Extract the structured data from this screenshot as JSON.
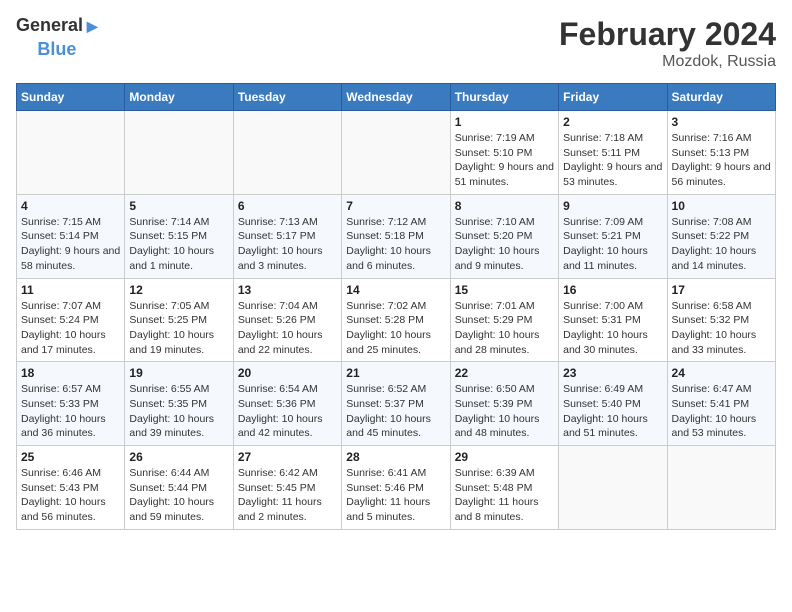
{
  "header": {
    "logo_line1": "General",
    "logo_line2": "Blue",
    "title": "February 2024",
    "subtitle": "Mozdok, Russia"
  },
  "weekdays": [
    "Sunday",
    "Monday",
    "Tuesday",
    "Wednesday",
    "Thursday",
    "Friday",
    "Saturday"
  ],
  "weeks": [
    [
      {
        "day": "",
        "info": ""
      },
      {
        "day": "",
        "info": ""
      },
      {
        "day": "",
        "info": ""
      },
      {
        "day": "",
        "info": ""
      },
      {
        "day": "1",
        "info": "Sunrise: 7:19 AM\nSunset: 5:10 PM\nDaylight: 9 hours and 51 minutes."
      },
      {
        "day": "2",
        "info": "Sunrise: 7:18 AM\nSunset: 5:11 PM\nDaylight: 9 hours and 53 minutes."
      },
      {
        "day": "3",
        "info": "Sunrise: 7:16 AM\nSunset: 5:13 PM\nDaylight: 9 hours and 56 minutes."
      }
    ],
    [
      {
        "day": "4",
        "info": "Sunrise: 7:15 AM\nSunset: 5:14 PM\nDaylight: 9 hours and 58 minutes."
      },
      {
        "day": "5",
        "info": "Sunrise: 7:14 AM\nSunset: 5:15 PM\nDaylight: 10 hours and 1 minute."
      },
      {
        "day": "6",
        "info": "Sunrise: 7:13 AM\nSunset: 5:17 PM\nDaylight: 10 hours and 3 minutes."
      },
      {
        "day": "7",
        "info": "Sunrise: 7:12 AM\nSunset: 5:18 PM\nDaylight: 10 hours and 6 minutes."
      },
      {
        "day": "8",
        "info": "Sunrise: 7:10 AM\nSunset: 5:20 PM\nDaylight: 10 hours and 9 minutes."
      },
      {
        "day": "9",
        "info": "Sunrise: 7:09 AM\nSunset: 5:21 PM\nDaylight: 10 hours and 11 minutes."
      },
      {
        "day": "10",
        "info": "Sunrise: 7:08 AM\nSunset: 5:22 PM\nDaylight: 10 hours and 14 minutes."
      }
    ],
    [
      {
        "day": "11",
        "info": "Sunrise: 7:07 AM\nSunset: 5:24 PM\nDaylight: 10 hours and 17 minutes."
      },
      {
        "day": "12",
        "info": "Sunrise: 7:05 AM\nSunset: 5:25 PM\nDaylight: 10 hours and 19 minutes."
      },
      {
        "day": "13",
        "info": "Sunrise: 7:04 AM\nSunset: 5:26 PM\nDaylight: 10 hours and 22 minutes."
      },
      {
        "day": "14",
        "info": "Sunrise: 7:02 AM\nSunset: 5:28 PM\nDaylight: 10 hours and 25 minutes."
      },
      {
        "day": "15",
        "info": "Sunrise: 7:01 AM\nSunset: 5:29 PM\nDaylight: 10 hours and 28 minutes."
      },
      {
        "day": "16",
        "info": "Sunrise: 7:00 AM\nSunset: 5:31 PM\nDaylight: 10 hours and 30 minutes."
      },
      {
        "day": "17",
        "info": "Sunrise: 6:58 AM\nSunset: 5:32 PM\nDaylight: 10 hours and 33 minutes."
      }
    ],
    [
      {
        "day": "18",
        "info": "Sunrise: 6:57 AM\nSunset: 5:33 PM\nDaylight: 10 hours and 36 minutes."
      },
      {
        "day": "19",
        "info": "Sunrise: 6:55 AM\nSunset: 5:35 PM\nDaylight: 10 hours and 39 minutes."
      },
      {
        "day": "20",
        "info": "Sunrise: 6:54 AM\nSunset: 5:36 PM\nDaylight: 10 hours and 42 minutes."
      },
      {
        "day": "21",
        "info": "Sunrise: 6:52 AM\nSunset: 5:37 PM\nDaylight: 10 hours and 45 minutes."
      },
      {
        "day": "22",
        "info": "Sunrise: 6:50 AM\nSunset: 5:39 PM\nDaylight: 10 hours and 48 minutes."
      },
      {
        "day": "23",
        "info": "Sunrise: 6:49 AM\nSunset: 5:40 PM\nDaylight: 10 hours and 51 minutes."
      },
      {
        "day": "24",
        "info": "Sunrise: 6:47 AM\nSunset: 5:41 PM\nDaylight: 10 hours and 53 minutes."
      }
    ],
    [
      {
        "day": "25",
        "info": "Sunrise: 6:46 AM\nSunset: 5:43 PM\nDaylight: 10 hours and 56 minutes."
      },
      {
        "day": "26",
        "info": "Sunrise: 6:44 AM\nSunset: 5:44 PM\nDaylight: 10 hours and 59 minutes."
      },
      {
        "day": "27",
        "info": "Sunrise: 6:42 AM\nSunset: 5:45 PM\nDaylight: 11 hours and 2 minutes."
      },
      {
        "day": "28",
        "info": "Sunrise: 6:41 AM\nSunset: 5:46 PM\nDaylight: 11 hours and 5 minutes."
      },
      {
        "day": "29",
        "info": "Sunrise: 6:39 AM\nSunset: 5:48 PM\nDaylight: 11 hours and 8 minutes."
      },
      {
        "day": "",
        "info": ""
      },
      {
        "day": "",
        "info": ""
      }
    ]
  ]
}
